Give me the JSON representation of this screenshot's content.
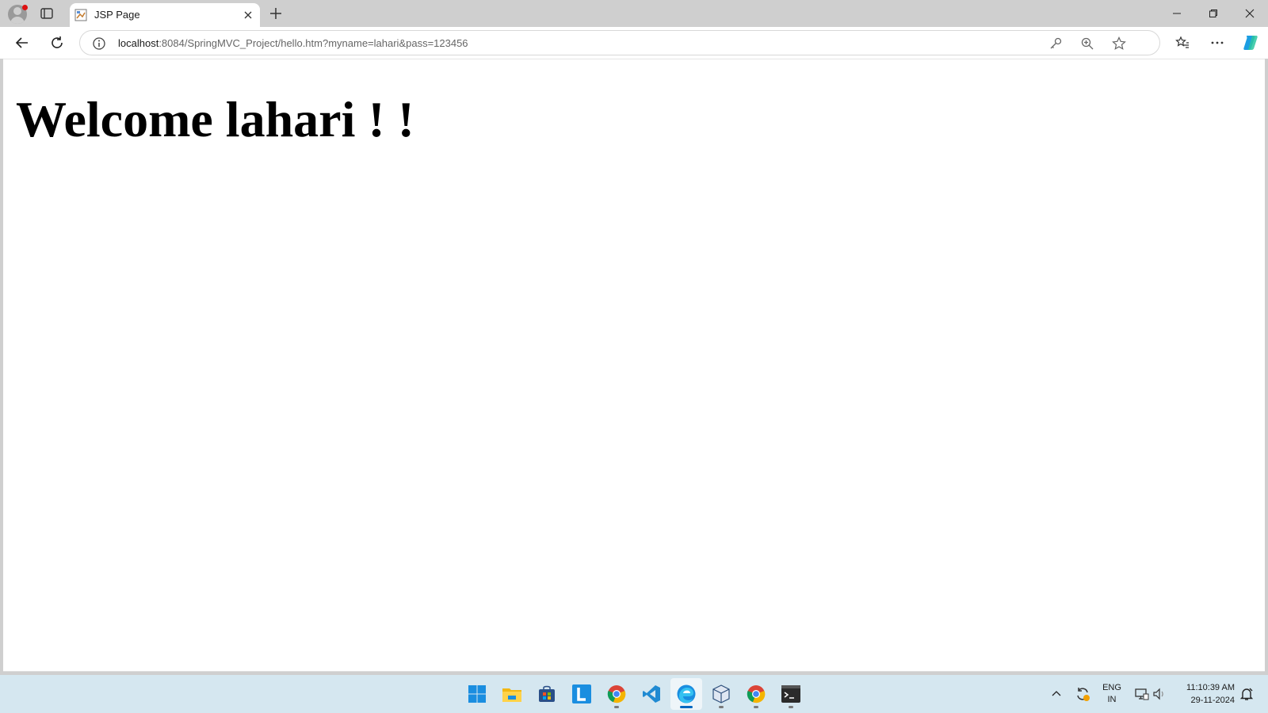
{
  "browser": {
    "tab": {
      "title": "JSP Page"
    },
    "address": {
      "host": "localhost",
      "path": ":8084/SpringMVC_Project/hello.htm?myname=lahari&pass=123456"
    }
  },
  "page": {
    "heading": "Welcome lahari ! !"
  },
  "taskbar": {
    "apps": [
      "start-icon",
      "file-explorer-icon",
      "store-icon",
      "l-app-icon",
      "chrome-icon",
      "vscode-icon",
      "edge-icon",
      "virtualbox-icon",
      "chrome-icon",
      "terminal-icon"
    ],
    "tray": {
      "lang_line1": "ENG",
      "lang_line2": "IN",
      "time": "11:10:39 AM",
      "date": "29-11-2024"
    }
  },
  "colors": {
    "accent": "#0067c0",
    "taskbar": "#d5e7f0",
    "titlebar": "#cfcfcf"
  }
}
